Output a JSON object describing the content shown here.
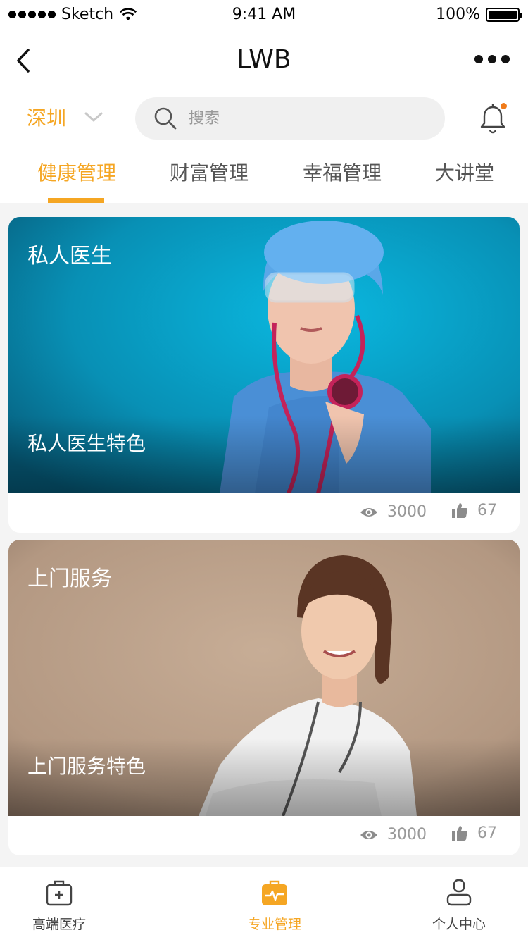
{
  "status_bar": {
    "carrier": "Sketch",
    "time": "9:41 AM",
    "battery": "100%"
  },
  "nav": {
    "title": "LWB"
  },
  "location": {
    "city": "深圳"
  },
  "search": {
    "placeholder": "搜索"
  },
  "tabs": [
    {
      "label": "健康管理",
      "active": true
    },
    {
      "label": "财富管理",
      "active": false
    },
    {
      "label": "幸福管理",
      "active": false
    },
    {
      "label": "大讲堂",
      "active": false
    }
  ],
  "cards": [
    {
      "title": "私人医生",
      "subtitle": "私人医生特色",
      "views": "3000",
      "likes": "67"
    },
    {
      "title": "上门服务",
      "subtitle": "上门服务特色",
      "views": "3000",
      "likes": "67"
    }
  ],
  "tabbar": [
    {
      "label": "高端医疗",
      "icon": "medical-kit-icon",
      "active": false
    },
    {
      "label": "专业管理",
      "icon": "briefcase-pulse-icon",
      "active": true
    },
    {
      "label": "个人中心",
      "icon": "user-icon",
      "active": false
    }
  ],
  "colors": {
    "accent": "#f5a623",
    "notification_dot": "#f07b1a"
  }
}
